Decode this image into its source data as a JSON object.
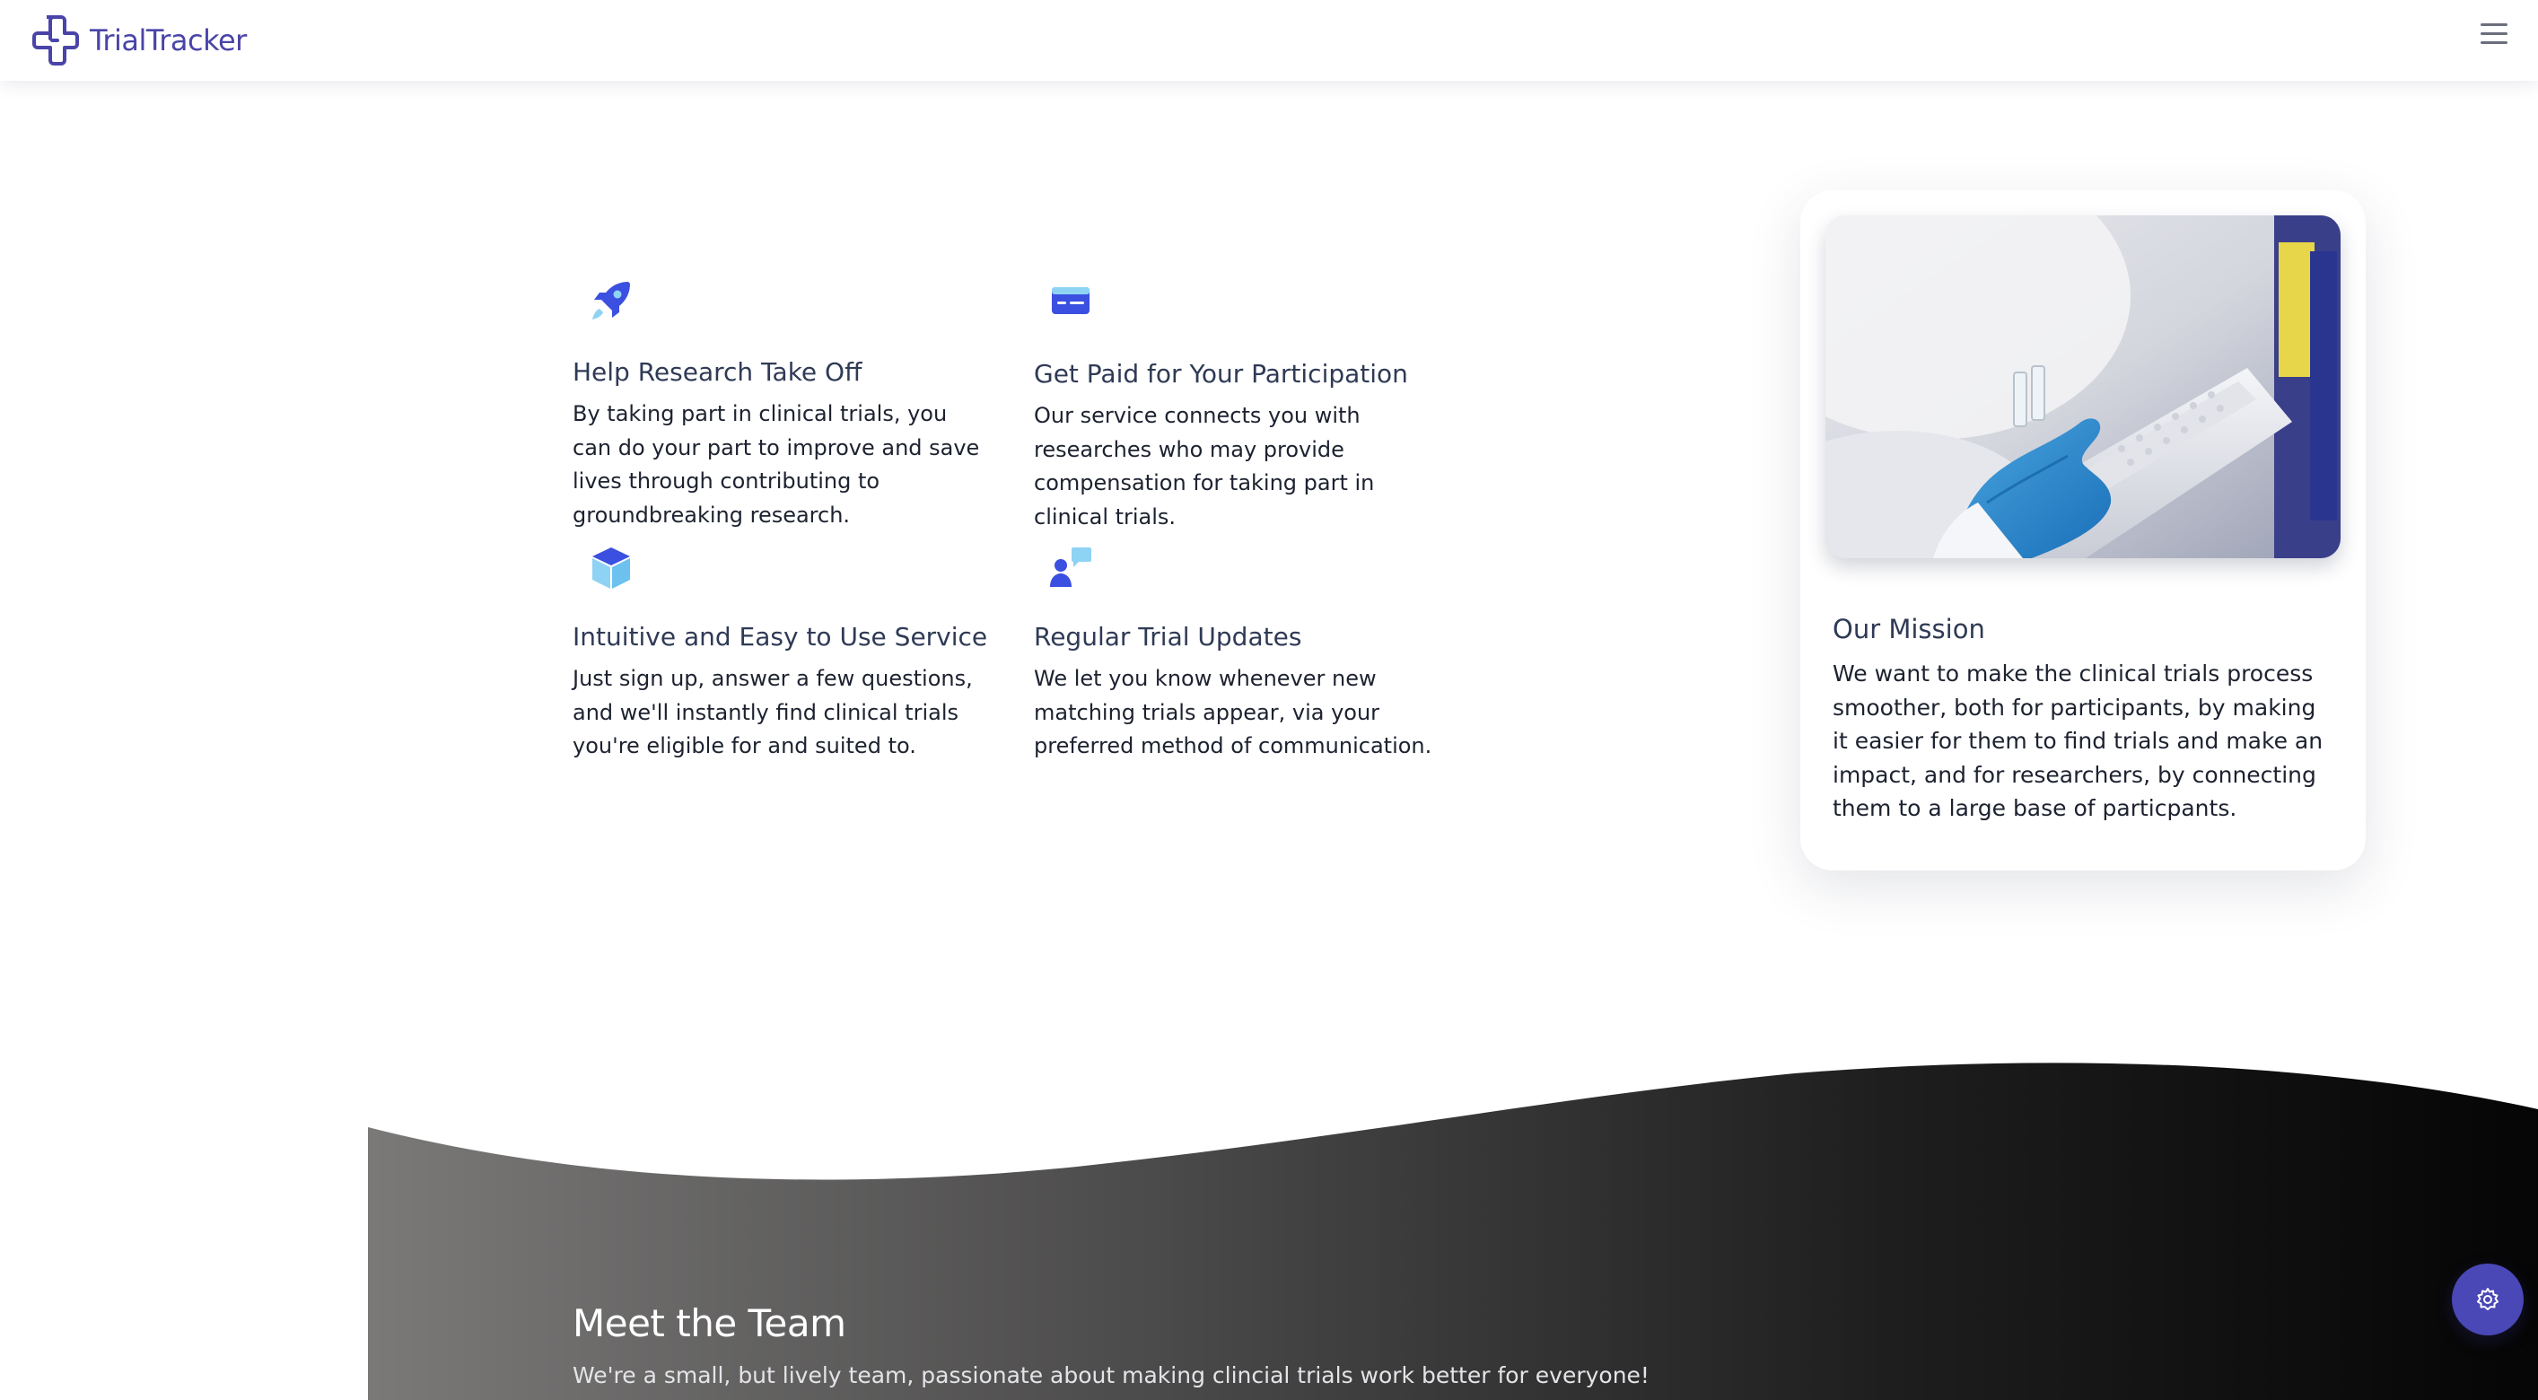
{
  "brand": {
    "name": "TrialTracker",
    "logo_icon": "medical-cross-logo-icon",
    "color": "#4a44a8"
  },
  "nav": {
    "menu_icon": "hamburger-menu-icon"
  },
  "features": [
    {
      "icon": "rocket-icon",
      "title": "Help Research Take Off",
      "text": "By taking part in clinical trials, you can do your part to improve and save lives through contributing to groundbreaking research."
    },
    {
      "icon": "credit-card-icon",
      "title": "Get Paid for Your Participation",
      "text": "Our service connects you with researches who may provide compensation for taking part in clinical trials."
    },
    {
      "icon": "box-icon",
      "title": "Intuitive and Easy to Use Service",
      "text": "Just sign up, answer a few questions, and we'll instantly find clinical trials you're eligible for and suited to."
    },
    {
      "icon": "user-chat-icon",
      "title": "Regular Trial Updates",
      "text": "We let you know whenever new matching trials appear, via your preferred method of communication."
    }
  ],
  "mission": {
    "image": "lab-gloved-hand-holding-vial-tray-photo",
    "title": "Our Mission",
    "text": "We want to make the clinical trials process smoother, both for participants, by making it easier for them to find trials and make an impact, and for researchers, by connecting them to a large base of particpants."
  },
  "team": {
    "title": "Meet the Team",
    "subtitle": "We're a small, but lively team, passionate about making clincial trials work better for everyone!"
  },
  "settings": {
    "icon": "gear-icon"
  },
  "colors": {
    "accent": "#3b4fe0",
    "accent_light": "#8fd3f4",
    "fab": "#4a47b6",
    "text": "#1d2230",
    "heading": "#2f3a55"
  }
}
